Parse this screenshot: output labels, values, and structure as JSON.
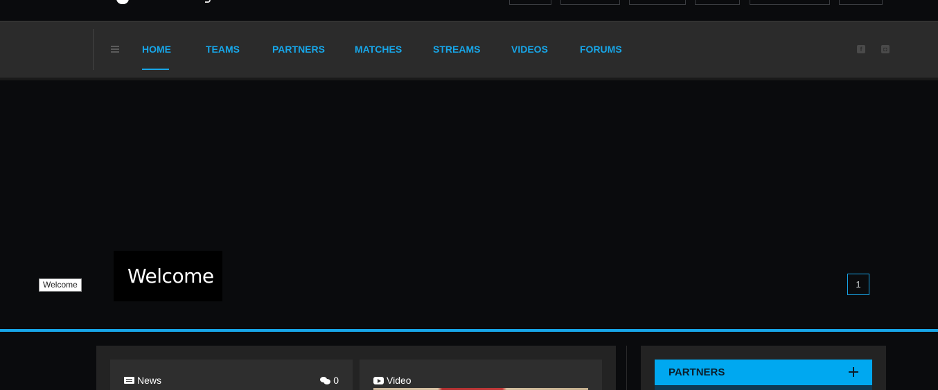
{
  "colors": {
    "accent": "#17a6e8",
    "background": "#0a0b0d",
    "navbar": "#2b2b2b",
    "partners_bar": "#00a8f0"
  },
  "nav": {
    "items": [
      {
        "label": "HOME",
        "active": true
      },
      {
        "label": "TEAMS"
      },
      {
        "label": "PARTNERS"
      },
      {
        "label": "MATCHES"
      },
      {
        "label": "STREAMS"
      },
      {
        "label": "VIDEOS"
      },
      {
        "label": "FORUMS"
      }
    ],
    "menu_icon": "hamburger-icon",
    "social_icons": [
      "facebook-icon",
      "discord-icon"
    ]
  },
  "hero": {
    "tooltip": "Welcome",
    "title": "Welcome",
    "slide_number": "1"
  },
  "content": {
    "news_card": {
      "icon": "newspaper-icon",
      "label": "News",
      "comments_icon": "comments-icon",
      "comments": "0"
    },
    "video_card": {
      "icon": "youtube-play-icon",
      "label": "Video"
    }
  },
  "sidebar": {
    "partners": {
      "title": "PARTNERS",
      "toggle_icon": "plus-icon"
    }
  }
}
